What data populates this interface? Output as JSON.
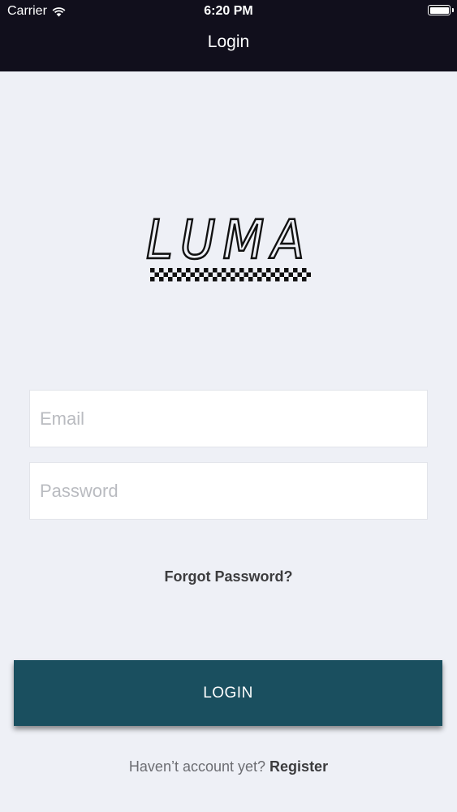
{
  "status_bar": {
    "carrier": "Carrier",
    "time": "6:20 PM",
    "battery_level": 1.0
  },
  "nav": {
    "title": "Login"
  },
  "logo": {
    "text": "LUMA"
  },
  "form": {
    "email_placeholder": "Email",
    "email_value": "",
    "password_placeholder": "Password",
    "password_value": ""
  },
  "forgot_password_label": "Forgot Password?",
  "login_button_label": "LOGIN",
  "register": {
    "prompt": "Haven’t account yet?",
    "link_label": "Register"
  },
  "colors": {
    "top_bar": "#110f1c",
    "background": "#eef0f6",
    "primary_button": "#1a4f5f"
  },
  "icons": [
    "wifi-icon",
    "battery-icon"
  ]
}
